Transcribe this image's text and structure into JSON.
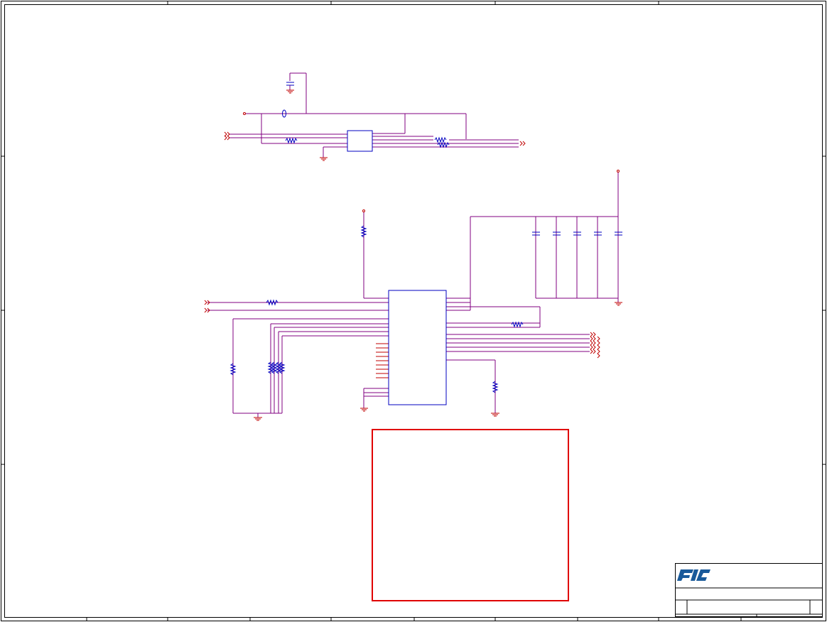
{
  "sheet": {
    "logo_text": "FIC"
  },
  "colors": {
    "border": "#000000",
    "wire": "#800080",
    "component": "#0000c0",
    "power_ground": "#c00000",
    "note_box": "#e00000",
    "logo": "#1a5a9a"
  }
}
